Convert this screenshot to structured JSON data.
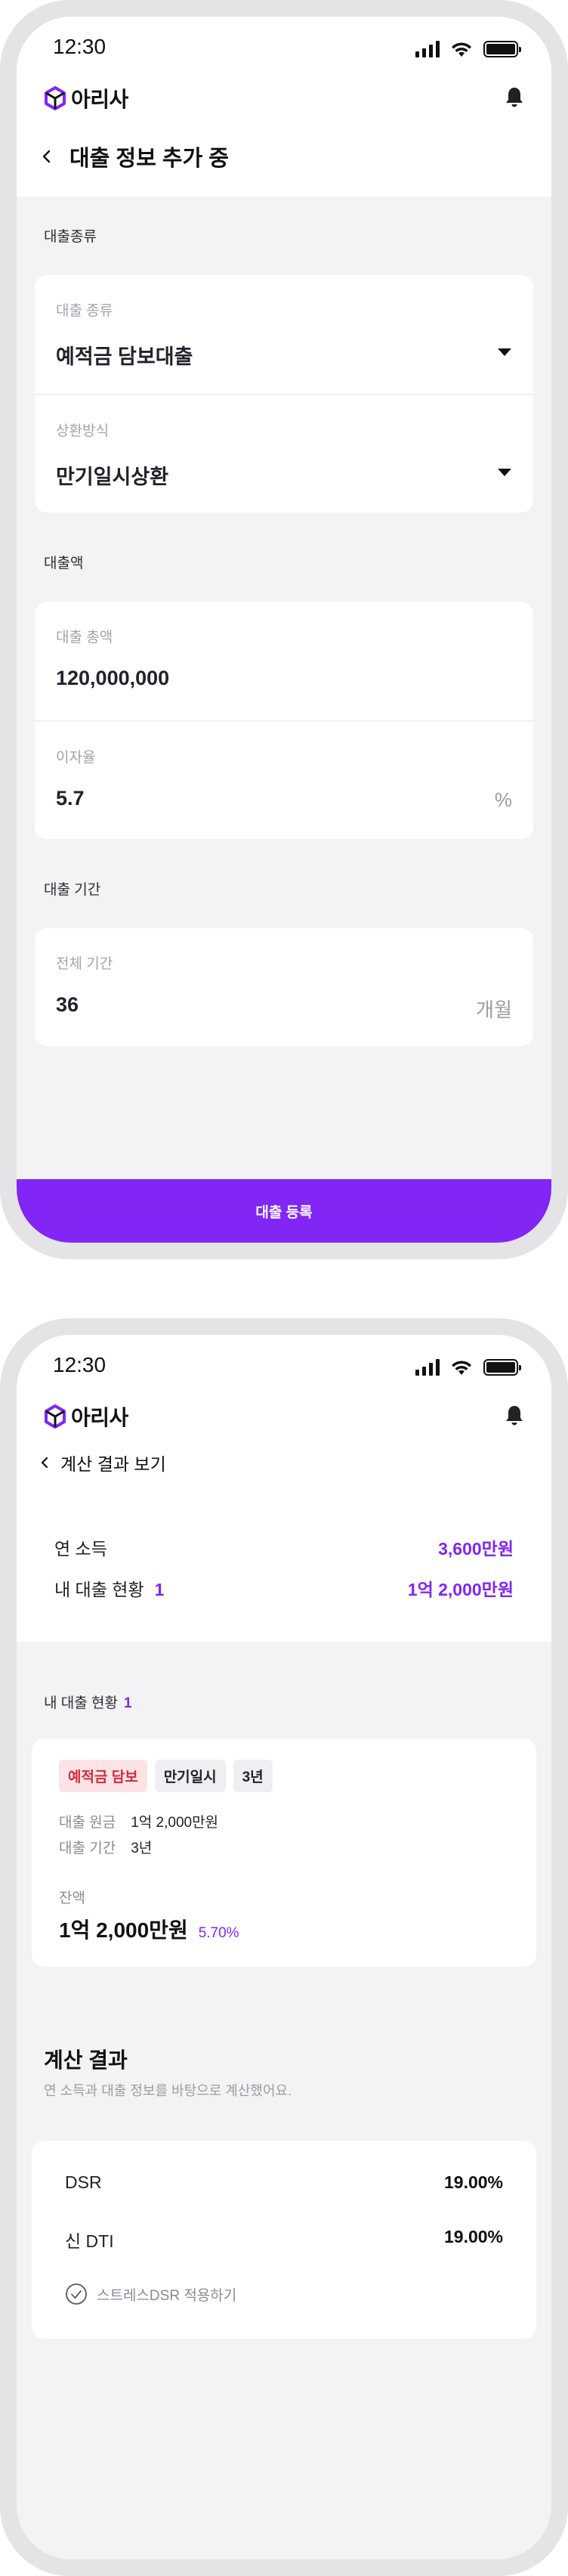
{
  "status_bar": {
    "time": "12:30"
  },
  "app": {
    "logo_text": "아리사"
  },
  "screen1": {
    "title": "대출 정보 추가 중",
    "sections": {
      "loan_type": "대출종류",
      "amount": "대출액",
      "period": "대출 기간"
    },
    "fields": {
      "loan_kind_label": "대출 종류",
      "loan_kind_value": "예적금 담보대출",
      "repayment_label": "상환방식",
      "repayment_value": "만기일시상환",
      "total_amount_label": "대출 총액",
      "total_amount_value": "120,000,000",
      "interest_label": "이자율",
      "interest_value": "5.7",
      "interest_unit": "%",
      "period_label": "전체 기간",
      "period_value": "36",
      "period_unit": "개월"
    },
    "submit_label": "대출 등록"
  },
  "screen2": {
    "title": "계산 결과 보기",
    "summary": {
      "income_label": "연 소득",
      "income_value": "3,600만원",
      "loans_label": "내 대출 현황",
      "loans_count": "1",
      "loans_value": "1억 2,000만원"
    },
    "section_label": "내 대출 현황",
    "section_count": "1",
    "loan": {
      "tags": [
        "예적금 담보",
        "만기일시",
        "3년"
      ],
      "principal_label": "대출 원금",
      "principal_value": "1억 2,000만원",
      "period_label": "대출 기간",
      "period_value": "3년",
      "balance_label": "잔액",
      "balance_value": "1억 2,000만원",
      "rate": "5.70%"
    },
    "calc": {
      "title": "계산 결과",
      "subtitle": "연 소득과 대출 정보를 바탕으로 계산했어요.",
      "dsr_label": "DSR",
      "dsr_value": "19.00%",
      "dti_label": "신 DTI",
      "dti_value": "19.00%",
      "stress_label": "스트레스DSR 적용하기"
    }
  },
  "colors": {
    "accent": "#8126f5",
    "tag_red_bg": "#fde3e5",
    "tag_red_text": "#cf2d3d"
  }
}
